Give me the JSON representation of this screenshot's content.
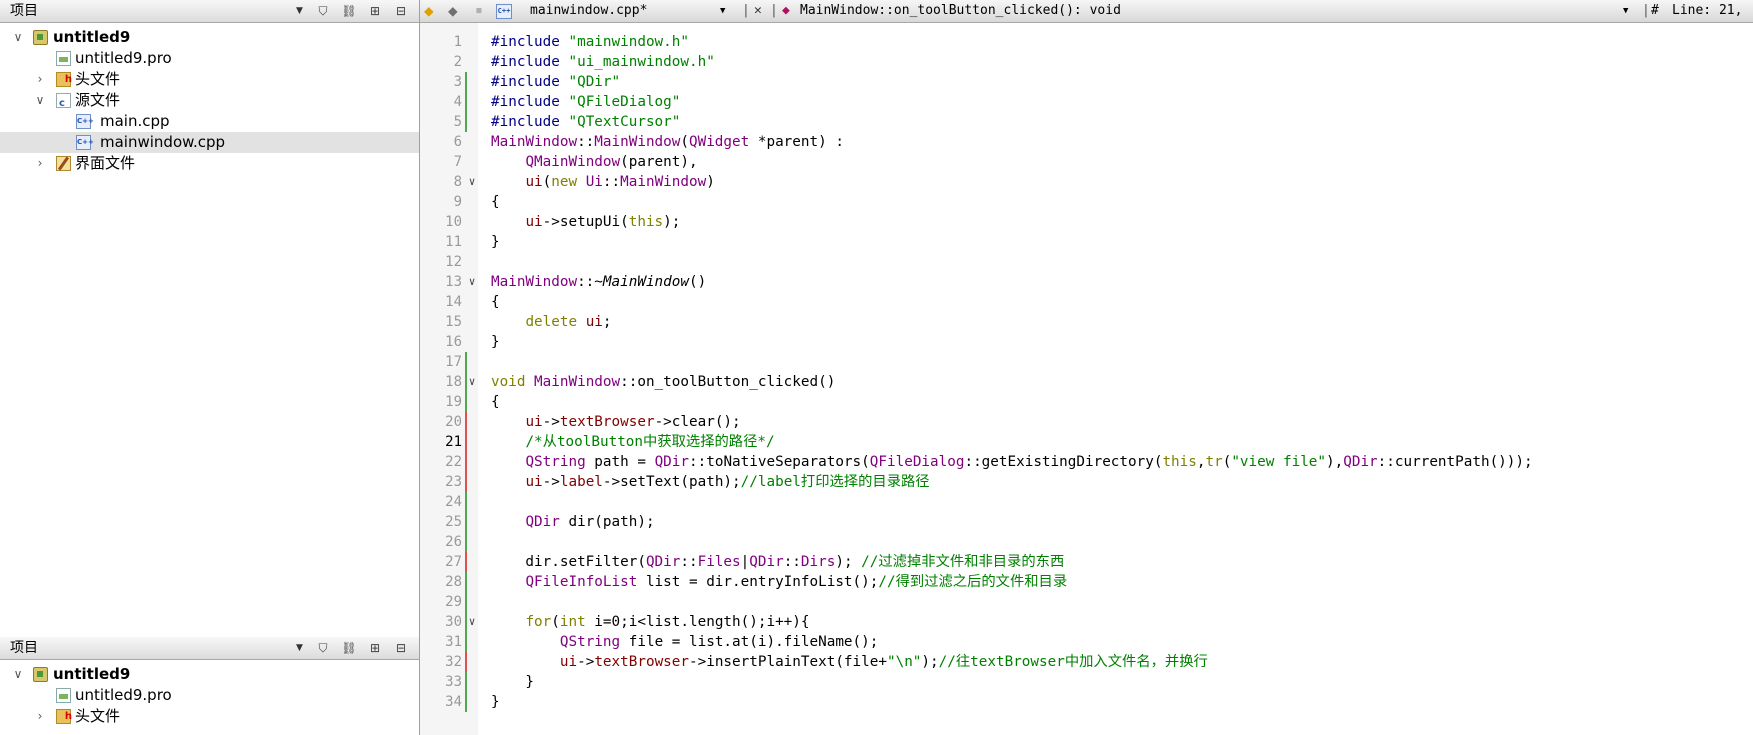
{
  "project_panel_top": {
    "title": "项目",
    "tree": [
      {
        "label": "untitled9",
        "bold": true
      },
      {
        "label": "untitled9.pro"
      },
      {
        "label": "头文件"
      },
      {
        "label": "源文件"
      },
      {
        "label": "main.cpp"
      },
      {
        "label": "mainwindow.cpp"
      },
      {
        "label": "界面文件"
      }
    ]
  },
  "project_panel_bottom": {
    "title": "项目",
    "tree": [
      {
        "label": "untitled9",
        "bold": true
      },
      {
        "label": "untitled9.pro"
      },
      {
        "label": "头文件"
      }
    ]
  },
  "editor_toolbar": {
    "file_name": "mainwindow.cpp*",
    "symbol": "MainWindow::on_toolButton_clicked(): void",
    "hash": "#",
    "line_info": "Line: 21,"
  },
  "code": {
    "current_line": 21,
    "lines": [
      "#include \"mainwindow.h\"",
      "#include \"ui_mainwindow.h\"",
      "#include \"QDir\"",
      "#include \"QFileDialog\"",
      "#include \"QTextCursor\"",
      "MainWindow::MainWindow(QWidget *parent) :",
      "    QMainWindow(parent),",
      "    ui(new Ui::MainWindow)",
      "{",
      "    ui->setupUi(this);",
      "}",
      "",
      "MainWindow::~MainWindow()",
      "{",
      "    delete ui;",
      "}",
      "",
      "void MainWindow::on_toolButton_clicked()",
      "{",
      "    ui->textBrowser->clear();",
      "    /*从toolButton中获取选择的路径*/",
      "    QString path = QDir::toNativeSeparators(QFileDialog::getExistingDirectory(this,tr(\"view file\"),QDir::currentPath()));",
      "    ui->label->setText(path);//label打印选择的目录路径",
      "",
      "    QDir dir(path);",
      "",
      "    dir.setFilter(QDir::Files|QDir::Dirs); //过滤掉非文件和非目录的东西",
      "    QFileInfoList list = dir.entryInfoList();//得到过滤之后的文件和目录",
      "",
      "    for(int i=0;i<list.length();i++){",
      "        QString file = list.at(i).fileName();",
      "        ui->textBrowser->insertPlainText(file+\"\\n\");//往textBrowser中加入文件名，并换行",
      "    }",
      "}"
    ]
  }
}
